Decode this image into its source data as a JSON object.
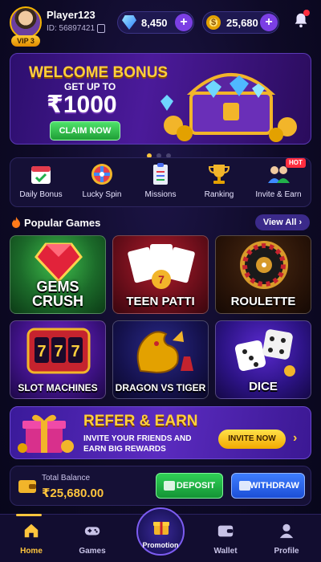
{
  "user": {
    "name": "Player123",
    "id": "ID: 56897421",
    "vip": "VIP 3"
  },
  "wallet_bar": {
    "gems": "8,450",
    "coins": "25,680"
  },
  "banner": {
    "title": "WELCOME BONUS",
    "subtitle": "GET UP TO",
    "amount": "₹1000",
    "button": "CLAIM NOW",
    "slides": 3,
    "active_slide": 1
  },
  "quick_actions": [
    {
      "label": "Daily Bonus",
      "icon": "calendar-check-icon"
    },
    {
      "label": "Lucky Spin",
      "icon": "spin-wheel-icon"
    },
    {
      "label": "Missions",
      "icon": "clipboard-icon"
    },
    {
      "label": "Ranking",
      "icon": "trophy-icon"
    },
    {
      "label": "Invite & Earn",
      "icon": "people-icon",
      "badge": "HOT"
    }
  ],
  "popular": {
    "title": "Popular Games",
    "view_all": "View All",
    "games": [
      {
        "label": "GEMS CRUSH",
        "icon": "gem-icon"
      },
      {
        "label": "TEEN PATTI",
        "icon": "playing-cards-icon"
      },
      {
        "label": "ROULETTE",
        "icon": "roulette-wheel-icon"
      },
      {
        "label": "SLOT MACHINES",
        "icon": "slot-machine-icon"
      },
      {
        "label": "DRAGON VS TIGER",
        "icon": "dragon-icon"
      },
      {
        "label": "DICE",
        "icon": "dice-icon"
      }
    ]
  },
  "refer": {
    "title": "REFER & EARN",
    "line1": "INVITE YOUR FRIENDS AND",
    "line2": "EARN BIG REWARDS",
    "button": "INVITE NOW"
  },
  "balance": {
    "label": "Total Balance",
    "value": "₹25,680.00",
    "deposit": "DEPOSIT",
    "withdraw": "WITHDRAW"
  },
  "nav": {
    "home": "Home",
    "games": "Games",
    "promotion": "Promotion",
    "wallet": "Wallet",
    "profile": "Profile"
  },
  "colors": {
    "accent_gold": "#ffc53d",
    "accent_purple": "#7b3fe4",
    "background": "#0e0a26"
  }
}
